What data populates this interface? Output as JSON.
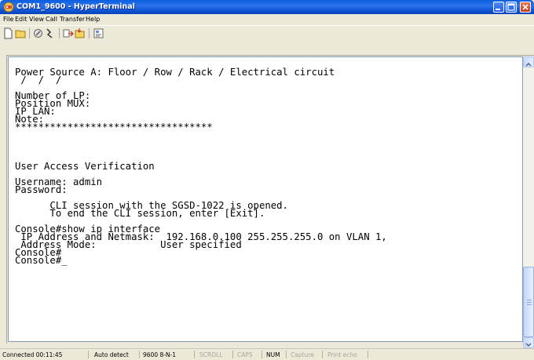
{
  "window": {
    "title": "COM1_9600 - HyperTerminal"
  },
  "menu": [
    "File",
    "Edit",
    "View",
    "Call",
    "Transfer",
    "Help"
  ],
  "toolbar": {
    "icons": [
      "new-connection-icon",
      "open-icon",
      "disconnect-icon",
      "disconnect-icon",
      "send-icon",
      "receive-icon",
      "properties-icon"
    ]
  },
  "terminal": {
    "lines": [
      "Power Source A: Floor / Row / Rack / Electrical circuit",
      " /  /  /",
      "",
      "Number of LP:",
      "Position MUX:",
      "IP LAN:",
      "Note:",
      "**********************************",
      "",
      "",
      "",
      "",
      "User Access Verification",
      "",
      "Username: admin",
      "Password:",
      "",
      "      CLI session with the SGSD-1022 is opened.",
      "      To end the CLI session, enter [Exit].",
      "",
      "Console#show ip interface",
      " IP Address and Netmask:  192.168.0.100 255.255.255.0 on VLAN 1,",
      " Address Mode:           User specified",
      "Console#",
      "Console#_"
    ]
  },
  "status": {
    "connected": "Connected 00:11:45",
    "detect": "Auto detect",
    "params": "9600 8-N-1",
    "scroll": "SCROLL",
    "caps": "CAPS",
    "num": "NUM",
    "capture": "Capture",
    "print_echo": "Print echo"
  },
  "colors": {
    "titlebar": "#0a5fe0",
    "terminal_bg": "#ffffff",
    "terminal_text": "#000000"
  }
}
